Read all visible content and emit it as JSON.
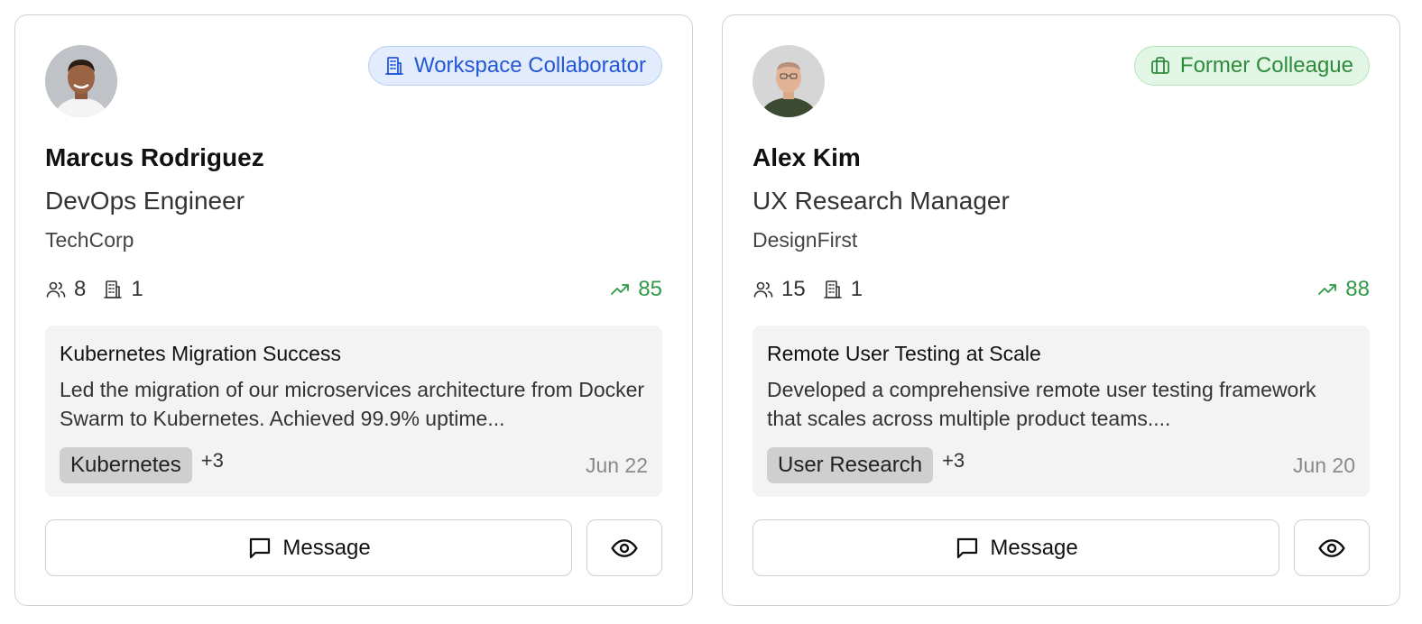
{
  "cards": [
    {
      "badge": {
        "label": "Workspace Collaborator",
        "icon": "building-icon",
        "color": "#2457d6"
      },
      "name": "Marcus Rodriguez",
      "title": "DevOps Engineer",
      "company": "TechCorp",
      "stats": {
        "connections": "8",
        "workspaces": "1",
        "score": "85"
      },
      "post": {
        "title": "Kubernetes Migration Success",
        "body": "Led the migration of our microservices architecture from Docker Swarm to Kubernetes. Achieved 99.9% uptime...",
        "tag": "Kubernetes",
        "more": "+3",
        "date": "Jun 22"
      },
      "actions": {
        "message": "Message"
      }
    },
    {
      "badge": {
        "label": "Former Colleague",
        "icon": "briefcase-icon",
        "color": "#2f8b3b"
      },
      "name": "Alex Kim",
      "title": "UX Research Manager",
      "company": "DesignFirst",
      "stats": {
        "connections": "15",
        "workspaces": "1",
        "score": "88"
      },
      "post": {
        "title": "Remote User Testing at Scale",
        "body": "Developed a comprehensive remote user testing framework that scales across multiple product teams....",
        "tag": "User Research",
        "more": "+3",
        "date": "Jun 20"
      },
      "actions": {
        "message": "Message"
      }
    }
  ]
}
